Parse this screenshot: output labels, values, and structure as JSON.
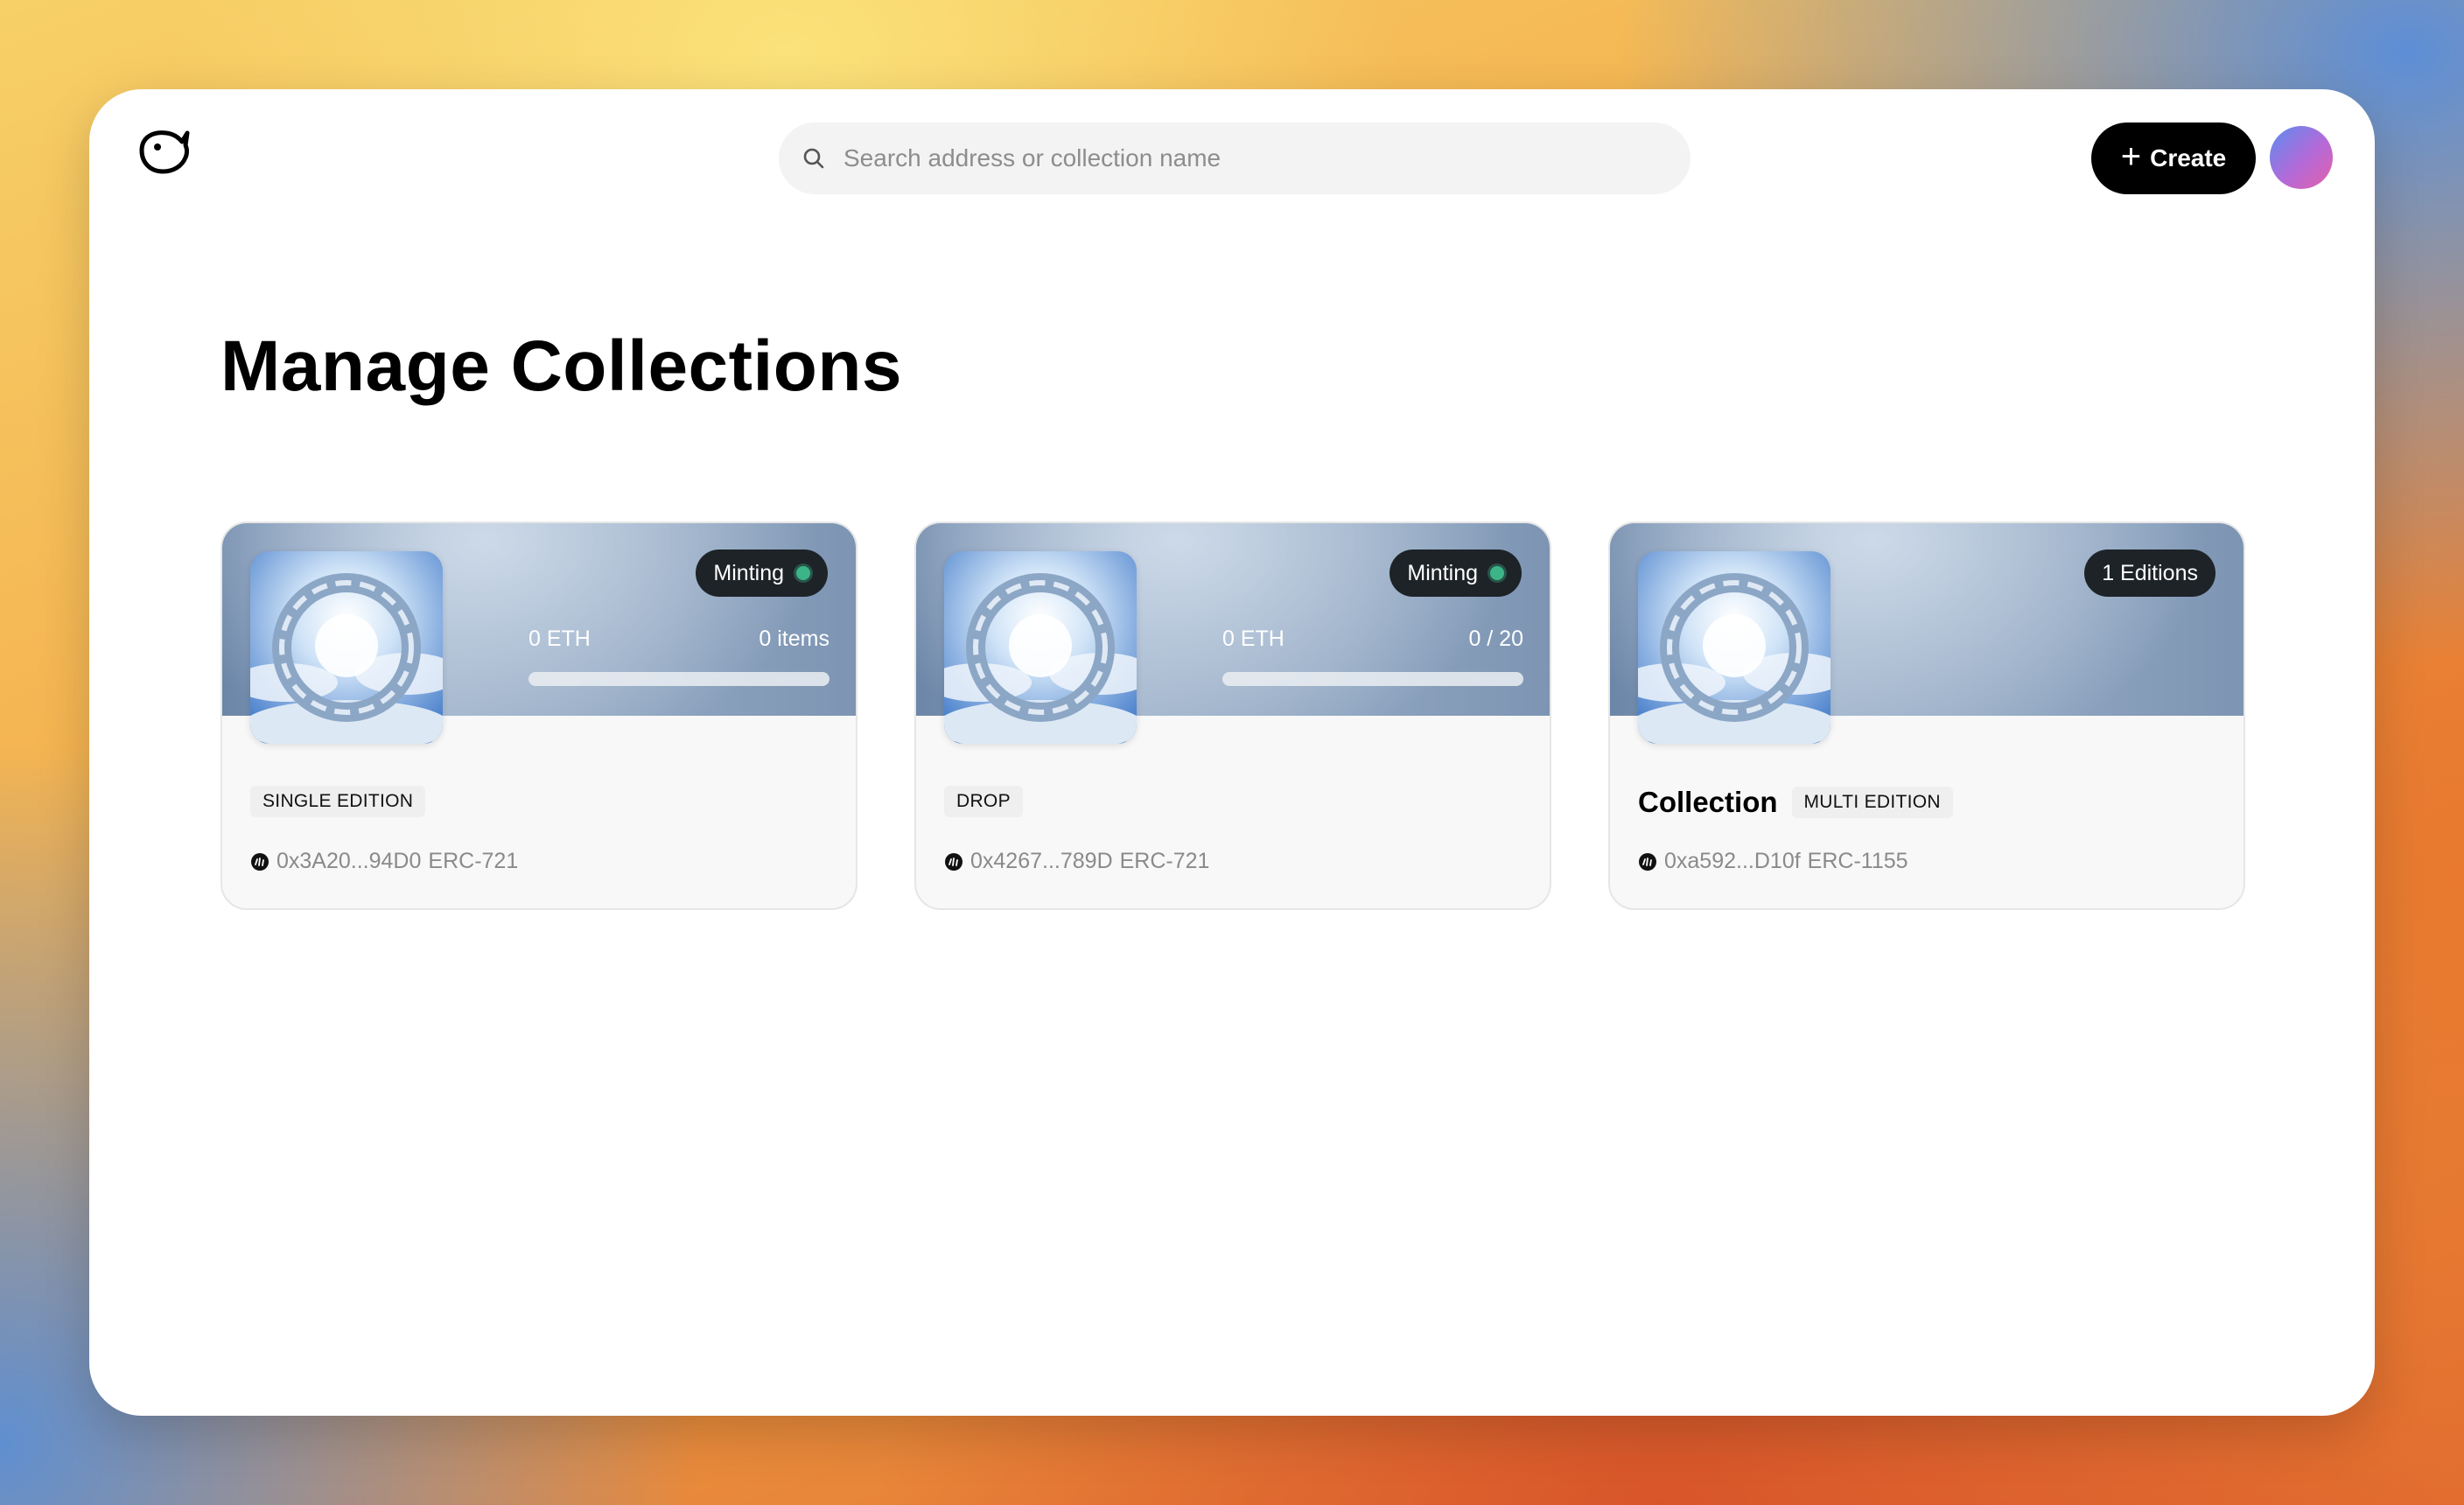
{
  "search": {
    "placeholder": "Search address or collection name"
  },
  "header": {
    "create_label": "Create"
  },
  "page": {
    "title": "Manage Collections"
  },
  "colors": {
    "accent": "#000000",
    "status_dot": "#3cb488",
    "pill_bg": "#1e2328"
  },
  "cards": [
    {
      "status": "Minting",
      "eth": "0 ETH",
      "count": "0 items",
      "progress": 0,
      "name": "",
      "type": "SINGLE EDITION",
      "address": "0x3A20...94D0",
      "standard": "ERC-721"
    },
    {
      "status": "Minting",
      "eth": "0 ETH",
      "count": "0 / 20",
      "progress": 0,
      "name": "",
      "type": "DROP",
      "address": "0x4267...789D",
      "standard": "ERC-721"
    },
    {
      "status": "1 Editions",
      "name": "Collection",
      "type": "MULTI EDITION",
      "address": "0xa592...D10f",
      "standard": "ERC-1155"
    }
  ]
}
